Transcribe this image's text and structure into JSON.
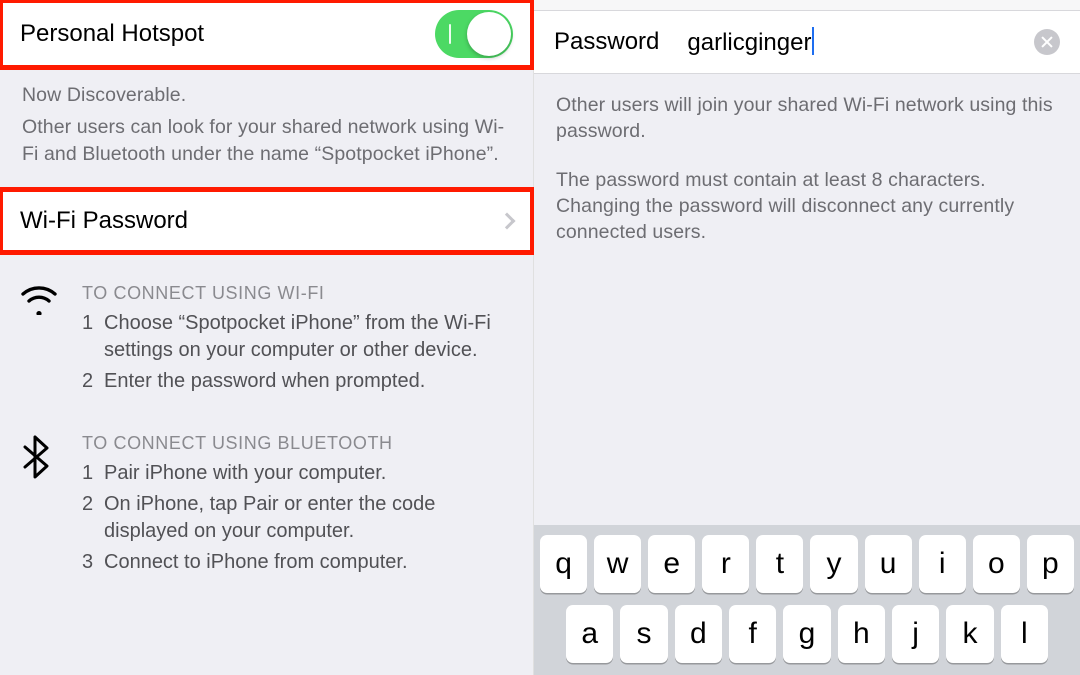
{
  "left": {
    "hotspot_label": "Personal Hotspot",
    "discoverable_title": "Now Discoverable.",
    "discoverable_body": "Other users can look for your shared network using Wi-Fi and Bluetooth under the name “Spotpocket iPhone”.",
    "wifi_password_label": "Wi-Fi Password",
    "wifi": {
      "title": "TO CONNECT USING WI-FI",
      "step1_num": "1",
      "step1": "Choose “Spotpocket iPhone” from the Wi-Fi settings on your computer or other device.",
      "step2_num": "2",
      "step2": "Enter the password when prompted."
    },
    "bt": {
      "title": "TO CONNECT USING BLUETOOTH",
      "step1_num": "1",
      "step1": "Pair iPhone with your computer.",
      "step2_num": "2",
      "step2": "On iPhone, tap Pair or enter the code displayed on your computer.",
      "step3_num": "3",
      "step3": "Connect to iPhone from computer."
    }
  },
  "right": {
    "password_label": "Password",
    "password_value": "garlicginger",
    "help1": "Other users will join your shared Wi-Fi network using this password.",
    "help2": "The password must contain at least 8 characters. Changing the password will disconnect any currently connected users."
  },
  "keyboard": {
    "row1": [
      "q",
      "w",
      "e",
      "r",
      "t",
      "y",
      "u",
      "i",
      "o",
      "p"
    ],
    "row2": [
      "a",
      "s",
      "d",
      "f",
      "g",
      "h",
      "j",
      "k",
      "l"
    ]
  }
}
